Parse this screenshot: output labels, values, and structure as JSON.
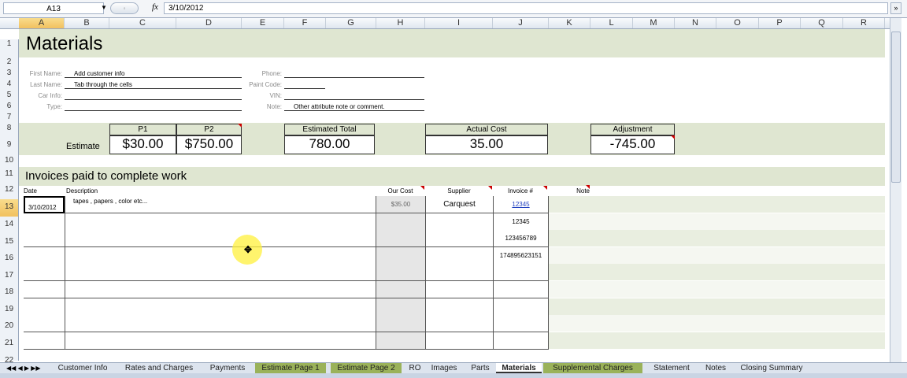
{
  "formula_bar": {
    "name_box": "A13",
    "fx": "fx",
    "content": "3/10/2012",
    "expand": "»"
  },
  "columns": [
    "A",
    "B",
    "C",
    "D",
    "E",
    "F",
    "G",
    "H",
    "I",
    "J",
    "K",
    "L",
    "M",
    "N",
    "O",
    "P",
    "Q",
    "R"
  ],
  "rows": [
    "1",
    "2",
    "3",
    "4",
    "5",
    "6",
    "7",
    "8",
    "9",
    "10",
    "11",
    "12",
    "13",
    "14",
    "15",
    "16",
    "17",
    "18",
    "19",
    "20",
    "21",
    "22"
  ],
  "sheet": {
    "title": "Materials",
    "customer": {
      "first_name_label": "First Name:",
      "first_name": "Add customer info",
      "last_name_label": "Last Name:",
      "last_name": "Tab through the cells",
      "car_info_label": "Car Info:",
      "type_label": "Type:",
      "phone_label": "Phone:",
      "paint_code_label": "Paint Code:",
      "vin_label": "VIN:",
      "note_label": "Note:",
      "note": "Other attribute note or comment."
    },
    "estimate_label": "Estimate",
    "p1_label": "P1",
    "p1": "$30.00",
    "p2_label": "P2",
    "p2": "$750.00",
    "estimated_total_label": "Estimated Total",
    "estimated_total": "780.00",
    "actual_cost_label": "Actual Cost",
    "actual_cost": "35.00",
    "adjustment_label": "Adjustment",
    "adjustment": "-745.00",
    "invoices_title": "Invoices paid to complete work",
    "table_headers": {
      "date": "Date",
      "description": "Description",
      "our_cost": "Our Cost",
      "supplier": "Supplier",
      "invoice": "Invoice #",
      "note": "Note"
    },
    "table_rows": [
      {
        "date": "3/10/2012",
        "description": "tapes , papers , color etc...",
        "our_cost": "$35.00",
        "supplier": "Carquest",
        "invoice": "12345"
      },
      {
        "date": "",
        "description": "",
        "our_cost": "",
        "supplier": "",
        "invoice": "12345"
      },
      {
        "date": "",
        "description": "",
        "our_cost": "",
        "supplier": "",
        "invoice": "123456789"
      },
      {
        "date": "",
        "description": "",
        "our_cost": "",
        "supplier": "",
        "invoice": "174895623151"
      }
    ]
  },
  "tabs": [
    "Customer Info",
    "Rates and Charges",
    "Payments",
    "Estimate Page 1",
    "Estimate Page 2",
    "RO",
    "Images",
    "Parts",
    "Materials",
    "Supplemental Charges",
    "Statement",
    "Notes",
    "Closing Summary"
  ],
  "tab_nav": "◀◀ ◀ ▶ ▶▶",
  "colors": {
    "band": "#dfe6d1",
    "highlight_tab": "#9ab25a",
    "link": "#1f3fbf"
  }
}
